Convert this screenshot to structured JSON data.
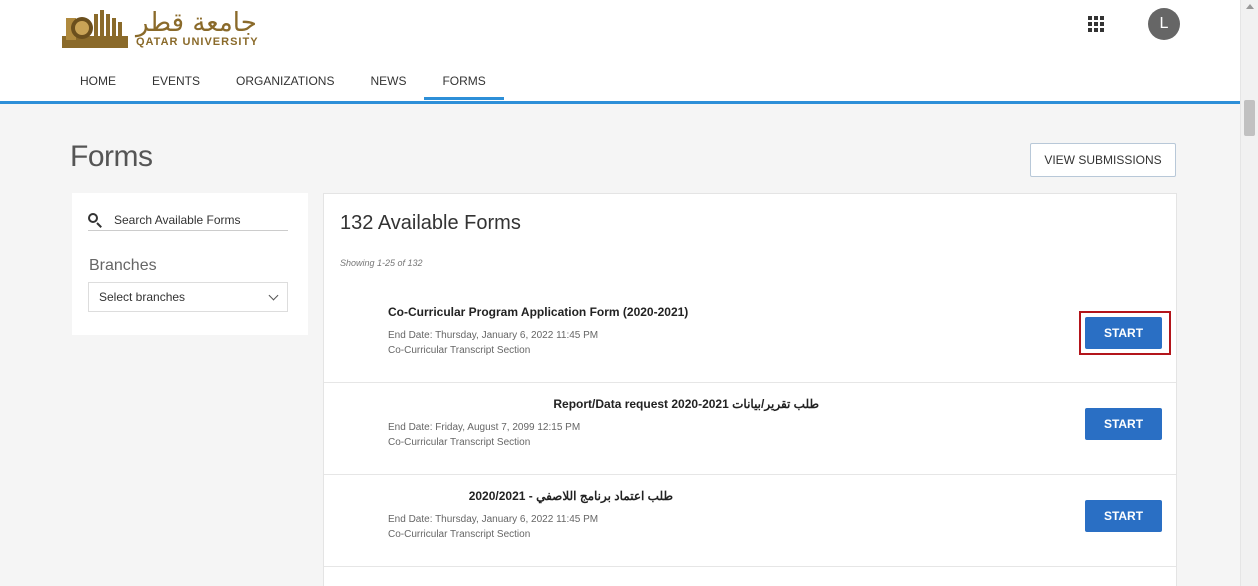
{
  "header": {
    "logo_arabic": "جامعة قطر",
    "logo_english": "QATAR UNIVERSITY",
    "apps_icon": "apps-grid-icon",
    "avatar_initial": "L"
  },
  "nav": {
    "items": [
      {
        "label": "HOME"
      },
      {
        "label": "EVENTS"
      },
      {
        "label": "ORGANIZATIONS"
      },
      {
        "label": "NEWS"
      },
      {
        "label": "FORMS",
        "active": true
      }
    ]
  },
  "page": {
    "title": "Forms",
    "view_submissions_label": "VIEW SUBMISSIONS"
  },
  "sidebar": {
    "search_placeholder": "Search Available Forms",
    "branches_label": "Branches",
    "branches_select": "Select branches"
  },
  "main": {
    "title": "132 Available Forms",
    "showing": "Showing 1-25 of 132",
    "forms": [
      {
        "title": "Co-Curricular Program Application Form (2020-2021)",
        "end_date": "End Date: Thursday, January 6, 2022 11:45 PM",
        "section": "Co-Curricular Transcript Section",
        "button": "START"
      },
      {
        "title": "طلب تقرير/بيانات Report/Data request 2020-2021",
        "end_date": "End Date: Friday, August 7, 2099 12:15 PM",
        "section": "Co-Curricular Transcript Section",
        "button": "START"
      },
      {
        "title": "طلب اعتماد برنامج اللاصفي - 2020/2021",
        "end_date": "End Date: Thursday, January 6, 2022 11:45 PM",
        "section": "Co-Curricular Transcript Section",
        "button": "START"
      }
    ]
  },
  "colors": {
    "accent": "#2d8fd8",
    "button": "#2a6fc4",
    "highlight": "#b3151b",
    "logo": "#8a6a2a"
  }
}
